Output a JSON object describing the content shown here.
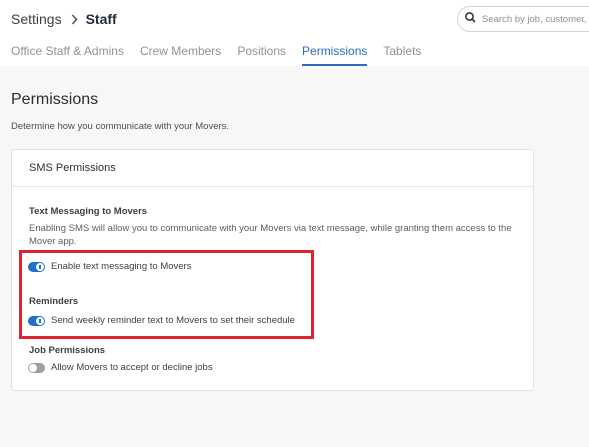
{
  "header": {
    "breadcrumb_root": "Settings",
    "breadcrumb_current": "Staff",
    "search_placeholder": "Search by job, customer, or",
    "tabs": [
      {
        "label": "Office Staff & Admins",
        "active": false
      },
      {
        "label": "Crew Members",
        "active": false
      },
      {
        "label": "Positions",
        "active": false
      },
      {
        "label": "Permissions",
        "active": true
      },
      {
        "label": "Tablets",
        "active": false
      }
    ]
  },
  "page": {
    "title": "Permissions",
    "subtitle": "Determine how you communicate with your Movers."
  },
  "card": {
    "title": "SMS Permissions",
    "sections": {
      "text_messaging": {
        "title": "Text Messaging to Movers",
        "description": "Enabling SMS will allow you to communicate with your Movers via text message, while granting them access to the Mover app.",
        "toggle_label": "Enable text messaging to Movers",
        "enabled": true
      },
      "reminders": {
        "title": "Reminders",
        "toggle_label": "Send weekly reminder text to Movers to set their schedule",
        "enabled": true
      },
      "job_permissions": {
        "title": "Job Permissions",
        "toggle_label": "Allow Movers to accept or decline jobs",
        "enabled": false
      }
    }
  },
  "colors": {
    "accent": "#2b6cc4",
    "toggle_on": "#1f6fd1",
    "toggle_off": "#9aa0a7",
    "highlight": "#e0232e"
  },
  "icons": {
    "breadcrumb_separator": "chevron-right-icon",
    "search": "search-icon"
  }
}
